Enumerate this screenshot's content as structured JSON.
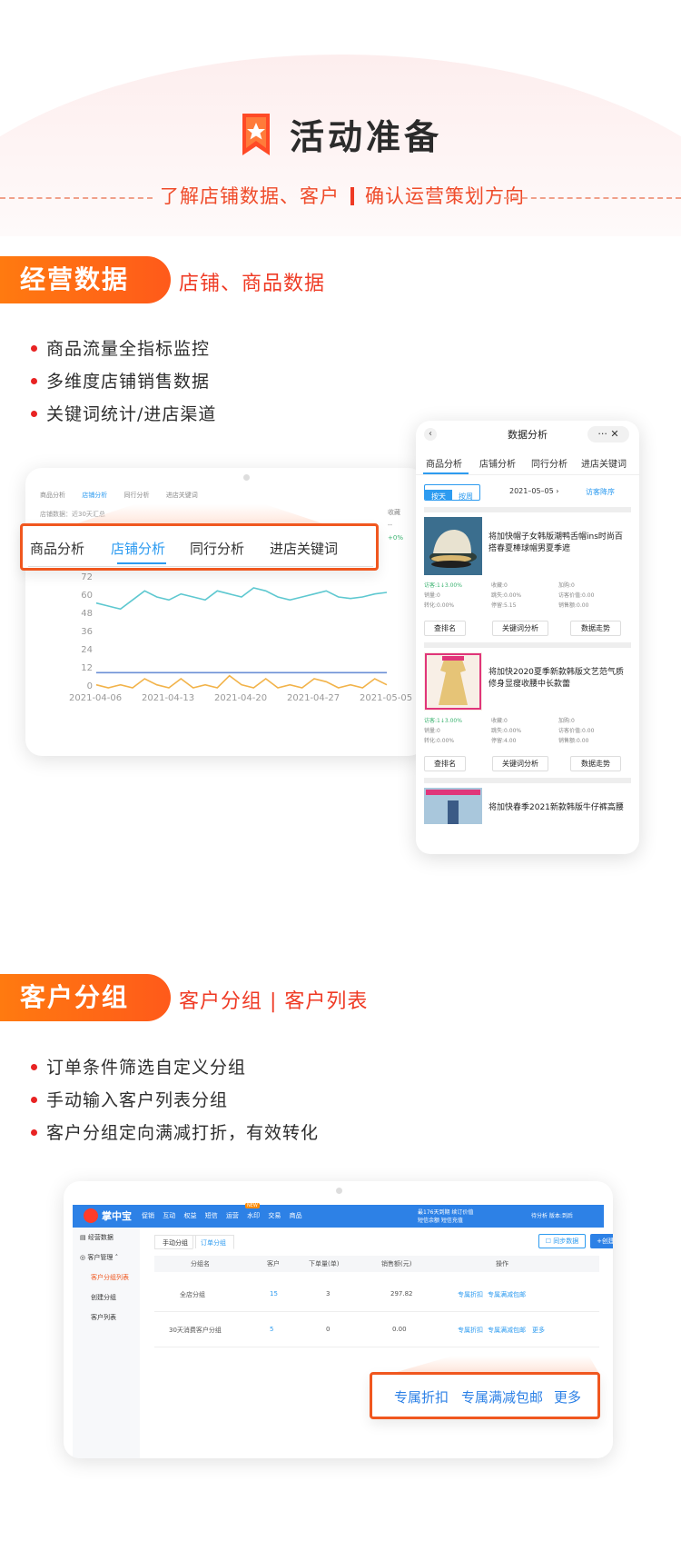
{
  "header": {
    "title": "活动准备",
    "subtitle_left": "了解店铺数据、客户",
    "subtitle_right": "确认运营策划方向"
  },
  "section1": {
    "ribbon": "经营数据",
    "side": "店铺、商品数据",
    "bullets": [
      "商品流量全指标监控",
      "多维度店铺销售数据",
      "关键词统计/进店渠道"
    ],
    "tablet": {
      "small_tabs": [
        "商品分析",
        "店铺分析",
        "同行分析",
        "进店关键词"
      ],
      "note": "店铺数据：近30天汇总",
      "right_label": "收藏",
      "right_value": "--",
      "right_change": "+0%",
      "big_tabs": [
        "商品分析",
        "店铺分析",
        "同行分析",
        "进店关键词"
      ],
      "y_ticks": [
        "72",
        "60",
        "48",
        "36",
        "24",
        "12",
        "0"
      ],
      "x_ticks": [
        "2021-04-06",
        "2021-04-13",
        "2021-04-20",
        "2021-04-27",
        "2021-05-05"
      ]
    },
    "phone": {
      "title": "数据分析",
      "back": "‹",
      "capsule": "··· ✕",
      "tabs": [
        "商品分析",
        "店铺分析",
        "同行分析",
        "进店关键词"
      ],
      "seg_on": "按天",
      "seg_off": "按周",
      "date": "2021–05–05 ›",
      "order": "访客降序",
      "products": [
        {
          "name": "将加快帽子女韩版潮鸭舌帽ins时尚百搭春夏棒球帽男夏季遮",
          "stats": [
            [
              "访客:1↓3.00%",
              "收藏:0",
              "加购:0"
            ],
            [
              "销量:0",
              "跳失:0.00%",
              "访客价值:0.00"
            ],
            [
              "转化:0.00%",
              "停留:5.15",
              "销售额:0.00"
            ]
          ],
          "buttons": [
            "查排名",
            "关键词分析",
            "数据走势"
          ]
        },
        {
          "name": "将加快2020夏季新款韩版文艺范气质修身显瘦收腰中长款蕾",
          "stats": [
            [
              "访客:1↓3.00%",
              "收藏:0",
              "加购:0"
            ],
            [
              "销量:0",
              "跳失:0.00%",
              "访客价值:0.00"
            ],
            [
              "转化:0.00%",
              "停留:4.00",
              "销售额:0.00"
            ]
          ],
          "buttons": [
            "查排名",
            "关键词分析",
            "数据走势"
          ]
        },
        {
          "name": "将加快春季2021新款韩版牛仔裤高腰"
        }
      ]
    },
    "chart_data": {
      "type": "line",
      "x": [
        "2021-04-06",
        "2021-04-13",
        "2021-04-20",
        "2021-04-27",
        "2021-05-05"
      ],
      "ylim": [
        0,
        72
      ],
      "y_ticks": [
        0,
        12,
        24,
        36,
        48,
        60,
        72
      ],
      "series": [
        {
          "color": "#5ec8d0",
          "values": [
            56,
            54,
            52,
            58,
            64,
            60,
            58,
            62,
            60,
            58,
            64,
            62,
            60,
            66,
            64,
            60,
            58,
            60,
            62,
            64,
            60,
            59,
            60,
            62,
            63
          ]
        },
        {
          "color": "#6b8fd6",
          "values": [
            10,
            10,
            10,
            10,
            10,
            10,
            10,
            10,
            10,
            10,
            10,
            10,
            10,
            10,
            10,
            10,
            10,
            10,
            10,
            10,
            10,
            10,
            10,
            10,
            10
          ]
        },
        {
          "color": "#f2b34a",
          "values": [
            2,
            0,
            2,
            0,
            6,
            2,
            0,
            6,
            0,
            2,
            0,
            8,
            2,
            0,
            6,
            0,
            2,
            0,
            6,
            4,
            0,
            2,
            0,
            6,
            2
          ]
        }
      ]
    }
  },
  "section2": {
    "ribbon": "客户分组",
    "side": "客户分组 | 客户列表",
    "bullets": [
      "订单条件筛选自定义分组",
      "手动输入客户列表分组",
      "客户分组定向满减打折，有效转化"
    ],
    "laptop": {
      "logo": "掌中宝",
      "nav": [
        "促销",
        "互动",
        "权益",
        "短信",
        "运营",
        "水印",
        "交易",
        "商品"
      ],
      "new_badge": "NEW",
      "top_right_1": "最176天到期 续订价值",
      "top_right_2": "短信余额 短信充值",
      "top_right_3": "待分析 版本:到后",
      "sidebar": [
        "经营数据",
        "客户管理",
        "客户分组列表",
        "创建分组",
        "客户列表"
      ],
      "tabs": [
        "手动分组",
        "订单分组"
      ],
      "btn_sync": "☐ 同步数据",
      "btn_add": "+创建分组",
      "headers": [
        "分组名",
        "客户",
        "下单量(单)",
        "销售额(元)",
        "操作"
      ],
      "rows": [
        {
          "name": "全店分组",
          "customers": "15",
          "orders": "3",
          "sales": "297.82",
          "ops": [
            "专属折扣",
            "专属满减包邮"
          ]
        },
        {
          "name": "30天消费客户分组",
          "customers": "5",
          "orders": "0",
          "sales": "0.00",
          "ops": [
            "专属折扣",
            "专属满减包邮",
            "更多"
          ]
        }
      ]
    },
    "ops_big": [
      "专属折扣",
      "专属满减包邮",
      "更多"
    ]
  }
}
